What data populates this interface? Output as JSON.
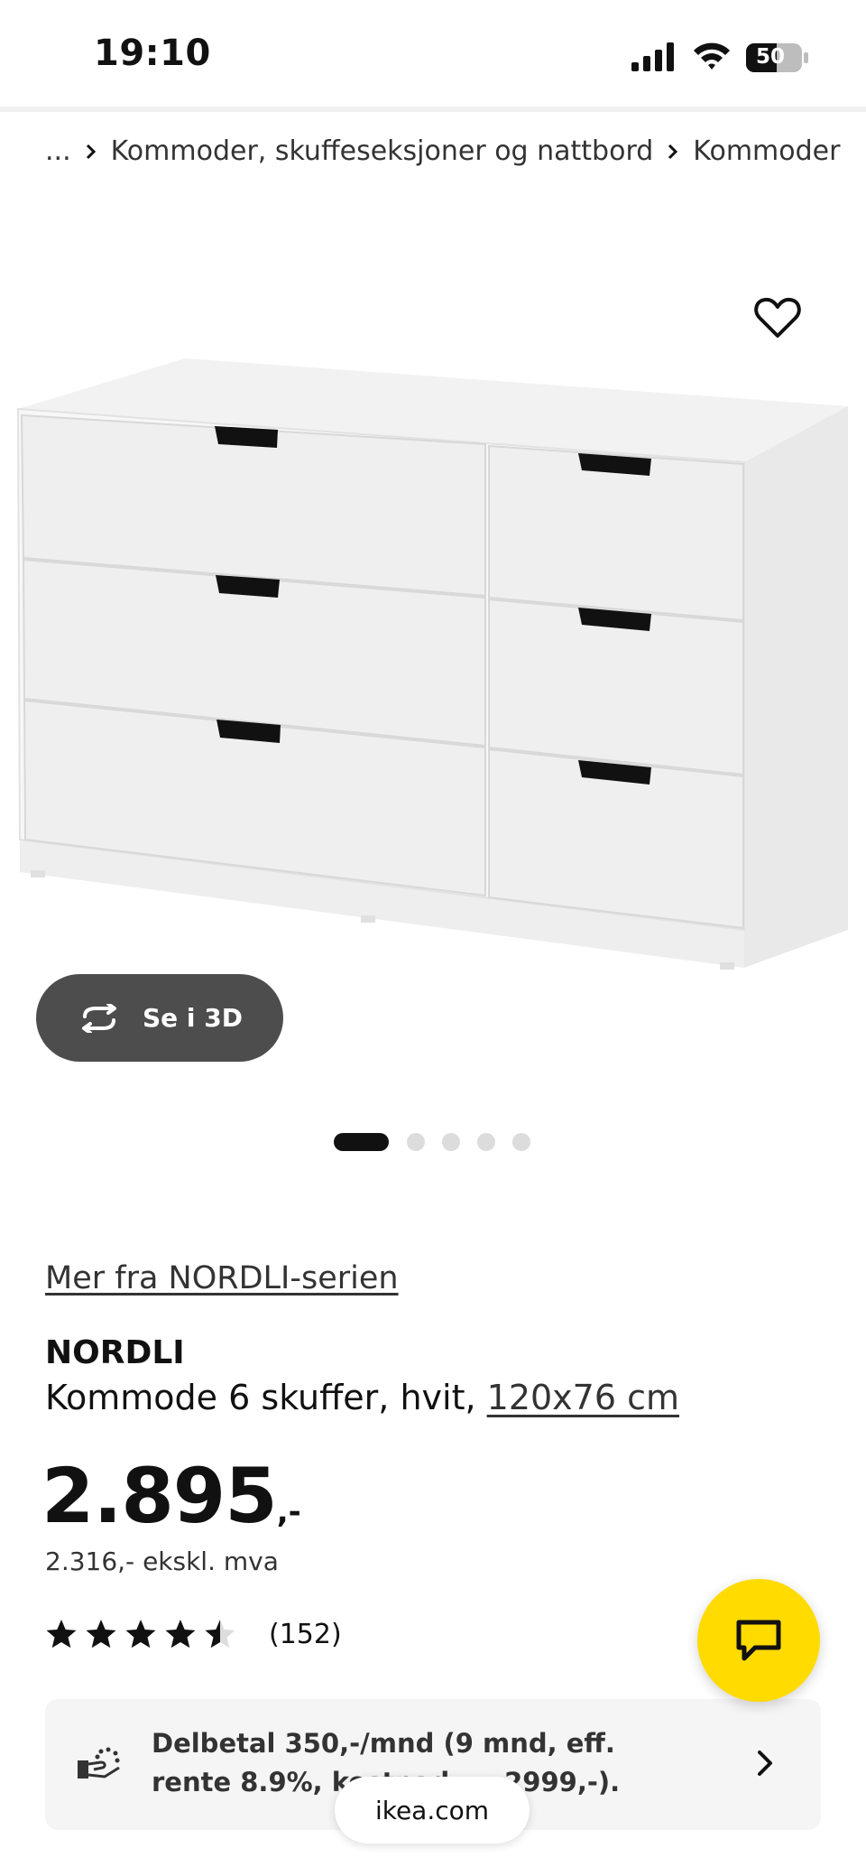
{
  "status_bar": {
    "time": "19:10",
    "battery_level": "50"
  },
  "breadcrumb": {
    "items": [
      "...",
      "Kommoder, skuffeseksjoner og nattbord",
      "Kommoder"
    ]
  },
  "product": {
    "series_link": "Mer fra NORDLI-serien",
    "name": "NORDLI",
    "description": "Kommode 6 skuffer, hvit, ",
    "size": "120x76 cm",
    "price_main": "2.895",
    "price_suffix": ",-",
    "price_ex_vat": "2.316,- ekskl. mva",
    "rating": 4.5,
    "review_count": "(152)"
  },
  "view_3d": {
    "label": "Se i 3D"
  },
  "carousel": {
    "total": 5,
    "active": 1
  },
  "financing": {
    "text": "Delbetal 350,-/mnd (9 mnd, eff. rente 8.9%, kostnad: … 2999,-)."
  },
  "browser": {
    "url": "ikea.com"
  },
  "colors": {
    "chat_yellow": "#ffdb00",
    "dark_button": "#4d4d4d"
  },
  "icons": [
    "signal-icon",
    "wifi-icon",
    "battery-icon",
    "heart-icon",
    "rotate-3d-icon",
    "chat-icon",
    "financing-icon",
    "chevron-right-icon",
    "star-icon"
  ]
}
